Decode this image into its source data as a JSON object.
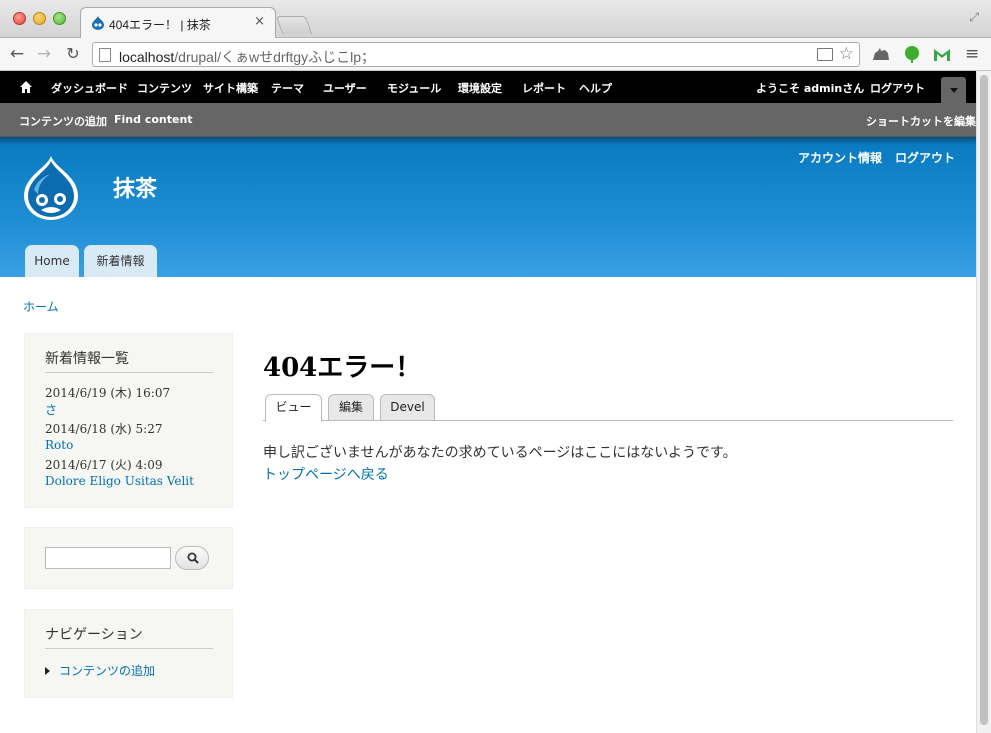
{
  "browser": {
    "tab_title": "404エラー！ | 抹茶",
    "tab_close": "×",
    "url_host": "localhost",
    "url_path": "/drupal/くぁwせdrftgyふじこlp；",
    "back_icon": "←",
    "forward_icon": "→",
    "reload_icon": "↻",
    "star_icon": "☆",
    "menu_icon": "≡",
    "expand_icon": "⤢"
  },
  "admin_toolbar": {
    "items": [
      "ダッシュボード",
      "コンテンツ",
      "サイト構築",
      "テーマ",
      "ユーザー",
      "モジュール",
      "環境設定",
      "レポート",
      "ヘルプ"
    ],
    "greeting": "ようこそ adminさん",
    "logout": "ログアウト"
  },
  "shortcut_bar": {
    "items": [
      "コンテンツの追加",
      "Find content"
    ],
    "edit_shortcuts": "ショートカットを編集"
  },
  "header": {
    "site_name": "抹茶",
    "secondary_menu": [
      "アカウント情報",
      "ログアウト"
    ],
    "main_menu": [
      "Home",
      "新着情報"
    ]
  },
  "breadcrumb": "ホーム",
  "sidebar": {
    "recent": {
      "title": "新着情報一覧",
      "items": [
        {
          "date": "2014/6/19 (木) 16:07",
          "title": "さ"
        },
        {
          "date": "2014/6/18 (水) 5:27",
          "title": "Roto"
        },
        {
          "date": "2014/6/17 (火) 4:09",
          "title": "Dolore Eligo Usitas Velit"
        }
      ]
    },
    "search": {
      "value": "",
      "placeholder": ""
    },
    "navigation": {
      "title": "ナビゲーション",
      "items": [
        "コンテンツの追加"
      ]
    }
  },
  "main": {
    "title": "404エラー！",
    "tabs": [
      "ビュー",
      "編集",
      "Devel"
    ],
    "message": "申し訳ございませんがあなたの求めているページはここにはないようです。",
    "home_link": "トップページへ戻る"
  },
  "colors": {
    "header_blue": "#1f8ed5",
    "link_blue": "#0071b3",
    "admin_black": "#000000",
    "shortcut_gray": "#666666"
  }
}
